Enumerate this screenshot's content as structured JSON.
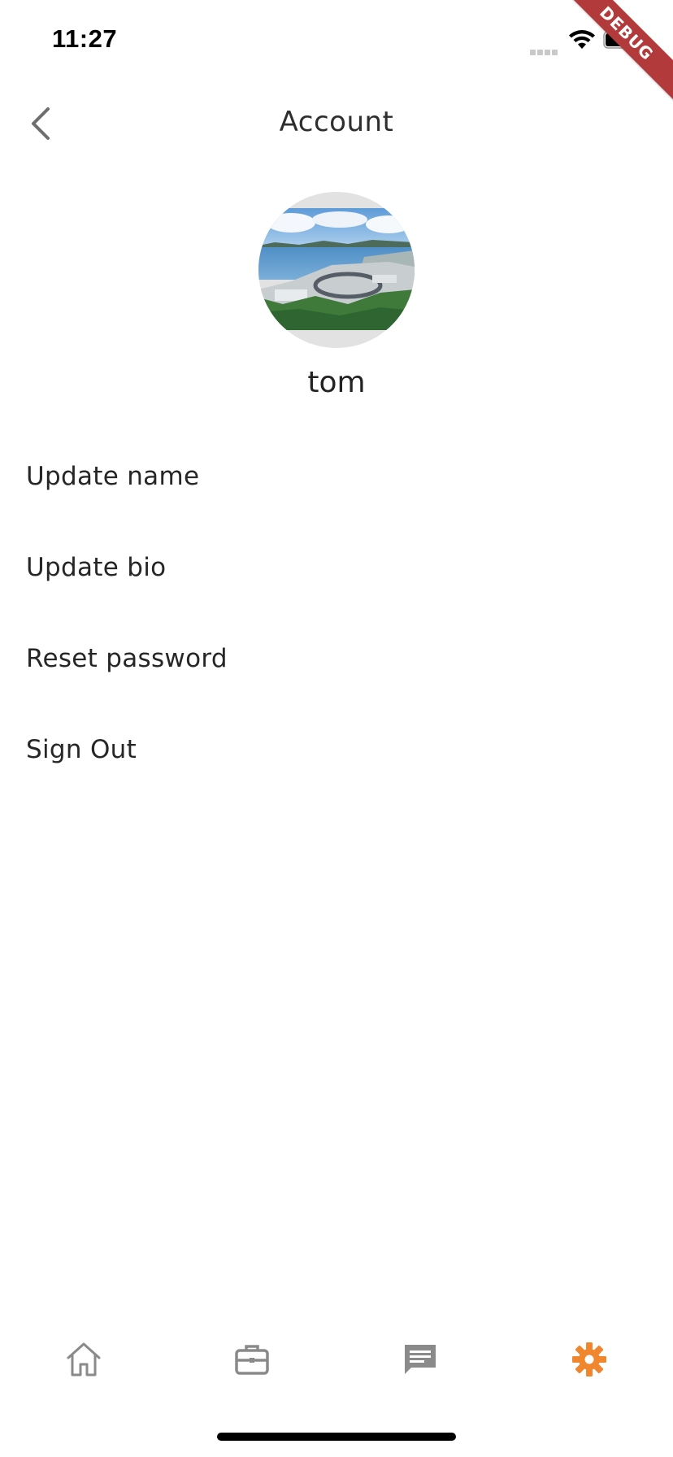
{
  "status_bar": {
    "time": "11:27"
  },
  "debug_banner": {
    "label": "DEBUG"
  },
  "app_bar": {
    "title": "Account",
    "back_icon": "chevron-left-icon"
  },
  "profile": {
    "name": "tom",
    "avatar_icon": "landscape-photo"
  },
  "menu": {
    "items": [
      {
        "label": "Update name"
      },
      {
        "label": "Update bio"
      },
      {
        "label": "Reset password"
      },
      {
        "label": "Sign Out"
      }
    ]
  },
  "bottom_nav": {
    "items": [
      {
        "icon": "home-icon",
        "active": false
      },
      {
        "icon": "briefcase-icon",
        "active": false
      },
      {
        "icon": "chat-icon",
        "active": false
      },
      {
        "icon": "gear-icon",
        "active": true
      }
    ],
    "active_color": "#F0862E",
    "inactive_color": "#8a8a8a"
  },
  "colors": {
    "debug_banner": "#B33A3A",
    "avatar_bg": "#E2E2E2"
  }
}
